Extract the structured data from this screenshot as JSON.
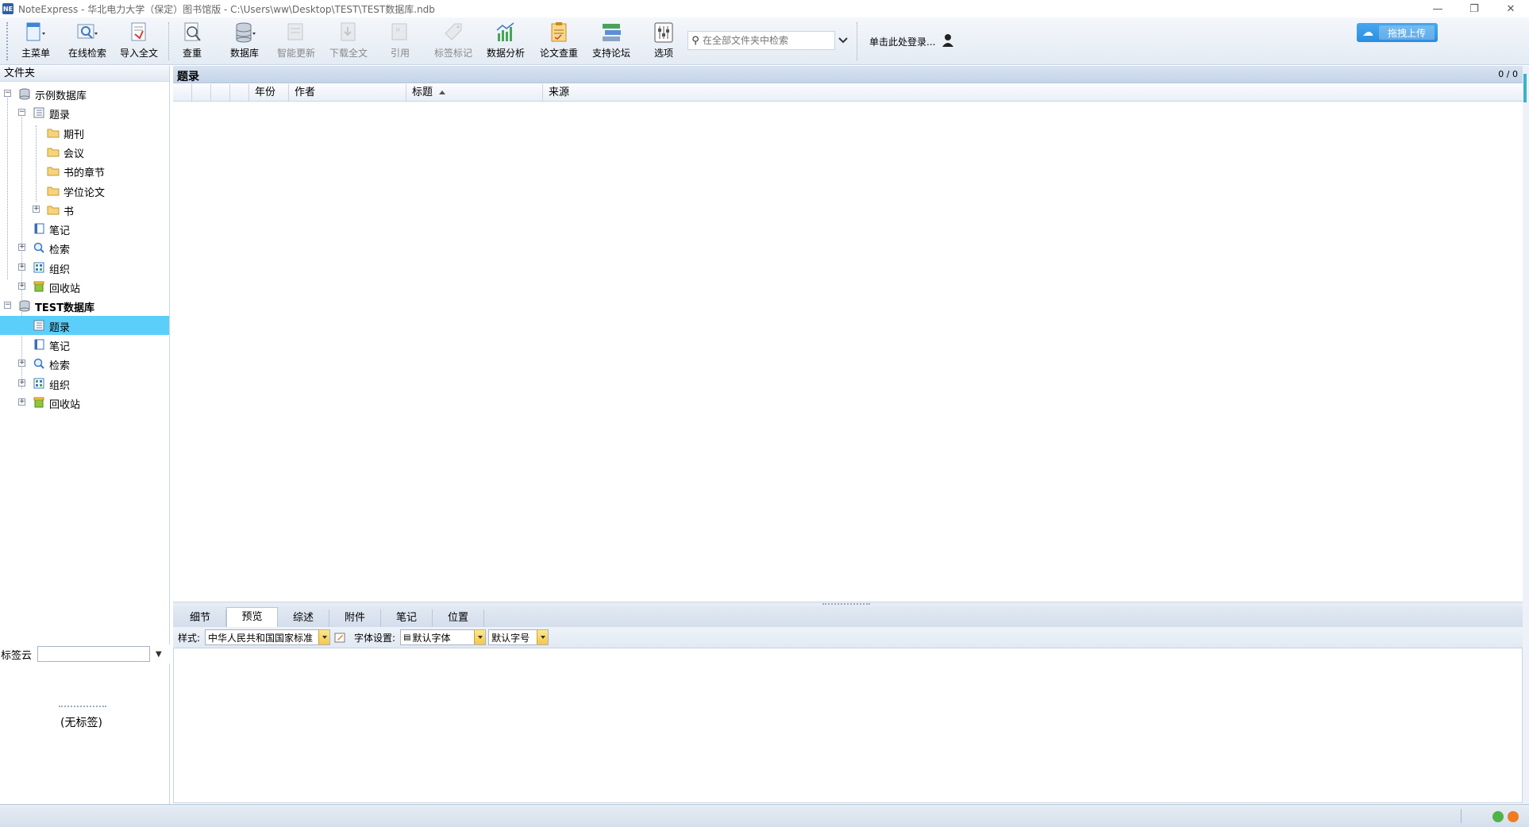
{
  "window": {
    "title": "NoteExpress - 华北电力大学（保定）图书馆版 - C:\\Users\\ww\\Desktop\\TEST\\TEST数据库.ndb",
    "app_icon_text": "NE",
    "minimize": "—",
    "restore": "❐",
    "close": "✕"
  },
  "toolbar": {
    "buttons": [
      {
        "label": "主菜单",
        "icon": "main-menu-icon"
      },
      {
        "label": "在线检索",
        "icon": "online-search-icon"
      },
      {
        "label": "导入全文",
        "icon": "import-fulltext-icon"
      },
      {
        "label": "查重",
        "icon": "check-duplicate-icon"
      },
      {
        "label": "数据库",
        "icon": "database-icon"
      },
      {
        "label": "智能更新",
        "icon": "smart-update-icon",
        "disabled": true
      },
      {
        "label": "下载全文",
        "icon": "download-fulltext-icon",
        "disabled": true
      },
      {
        "label": "引用",
        "icon": "cite-icon",
        "disabled": true
      },
      {
        "label": "标签标记",
        "icon": "tag-mark-icon",
        "disabled": true
      },
      {
        "label": "数据分析",
        "icon": "data-analysis-icon"
      },
      {
        "label": "论文查重",
        "icon": "paper-check-icon"
      },
      {
        "label": "支持论坛",
        "icon": "support-forum-icon"
      },
      {
        "label": "选项",
        "icon": "options-icon"
      }
    ],
    "search_placeholder": "在全部文件夹中检索",
    "login_text": "单击此处登录...",
    "upload_label": "拖拽上传"
  },
  "left_panel": {
    "header": "文件夹",
    "tree": [
      {
        "label": "示例数据库",
        "icon": "database-icon",
        "bold": false,
        "expander": "−"
      },
      {
        "label": "题录",
        "icon": "records-icon",
        "expander": "−"
      },
      {
        "label": "期刊",
        "icon": "folder-icon"
      },
      {
        "label": "会议",
        "icon": "folder-icon"
      },
      {
        "label": "书的章节",
        "icon": "folder-icon"
      },
      {
        "label": "学位论文",
        "icon": "folder-icon"
      },
      {
        "label": "书",
        "icon": "folder-icon",
        "expander": "+"
      },
      {
        "label": "笔记",
        "icon": "notes-icon"
      },
      {
        "label": "检索",
        "icon": "search-icon",
        "expander": "+"
      },
      {
        "label": "组织",
        "icon": "organize-icon",
        "expander": "+"
      },
      {
        "label": "回收站",
        "icon": "recycle-bin-icon",
        "expander": "+"
      },
      {
        "label": "TEST数据库",
        "icon": "database-icon",
        "bold": true,
        "expander": "−"
      },
      {
        "label": "题录",
        "icon": "records-icon",
        "selected": true
      },
      {
        "label": "笔记",
        "icon": "notes-icon"
      },
      {
        "label": "检索",
        "icon": "search-icon",
        "expander": "+"
      },
      {
        "label": "组织",
        "icon": "organize-icon",
        "expander": "+"
      },
      {
        "label": "回收站",
        "icon": "recycle-bin-icon",
        "expander": "+"
      }
    ],
    "tag_cloud_label": "标签云",
    "no_tags": "(无标签)"
  },
  "main": {
    "title": "题录",
    "count": "0 / 0",
    "columns": [
      "年份",
      "作者",
      "标题",
      "来源"
    ],
    "sorted_column": "标题",
    "rows": []
  },
  "detail": {
    "tabs": [
      "细节",
      "预览",
      "综述",
      "附件",
      "笔记",
      "位置"
    ],
    "active_tab": "预览",
    "style_label": "样式:",
    "style_value": "中华人民共和国国家标准",
    "font_label": "字体设置:",
    "font_value": "默认字体",
    "size_value": "默认字号"
  },
  "colors": {
    "selection": "#5bcffa",
    "accent": "#2b8de0",
    "toolbar_bg": "#e4ebf4"
  }
}
